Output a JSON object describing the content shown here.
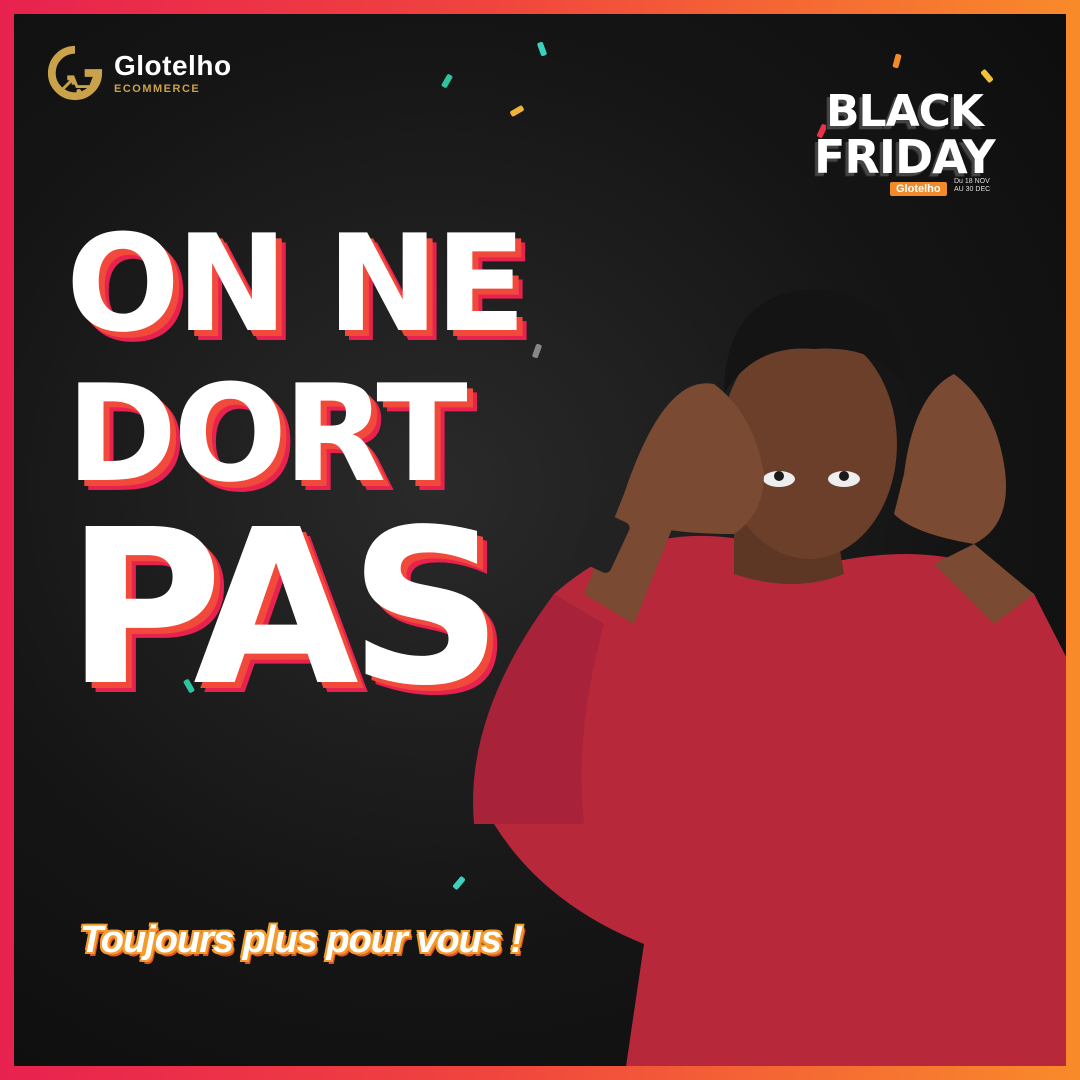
{
  "logo": {
    "name": "Glotelho",
    "subtitle": "ECOMMERCE",
    "mark_letter": "G",
    "brand_color": "#c9a24a"
  },
  "badge": {
    "line1": "BLACK",
    "line2": "FRIDAY",
    "tag": "Glotelho",
    "dates": "Du 18 NOV AU 30 DEC"
  },
  "headline": {
    "line1": "ON NE",
    "line2": "DORT",
    "line3": "PAS"
  },
  "tagline": "Toujours plus pour vous !",
  "colors": {
    "frame_start": "#e8224f",
    "frame_end": "#f98a2a",
    "background": "#151515",
    "sweater": "#b8283b",
    "skin": "#6b3f2a",
    "tagline_outline": "#f49b2b"
  },
  "icons": {
    "logo_mark": "cart-arrow-icon"
  }
}
